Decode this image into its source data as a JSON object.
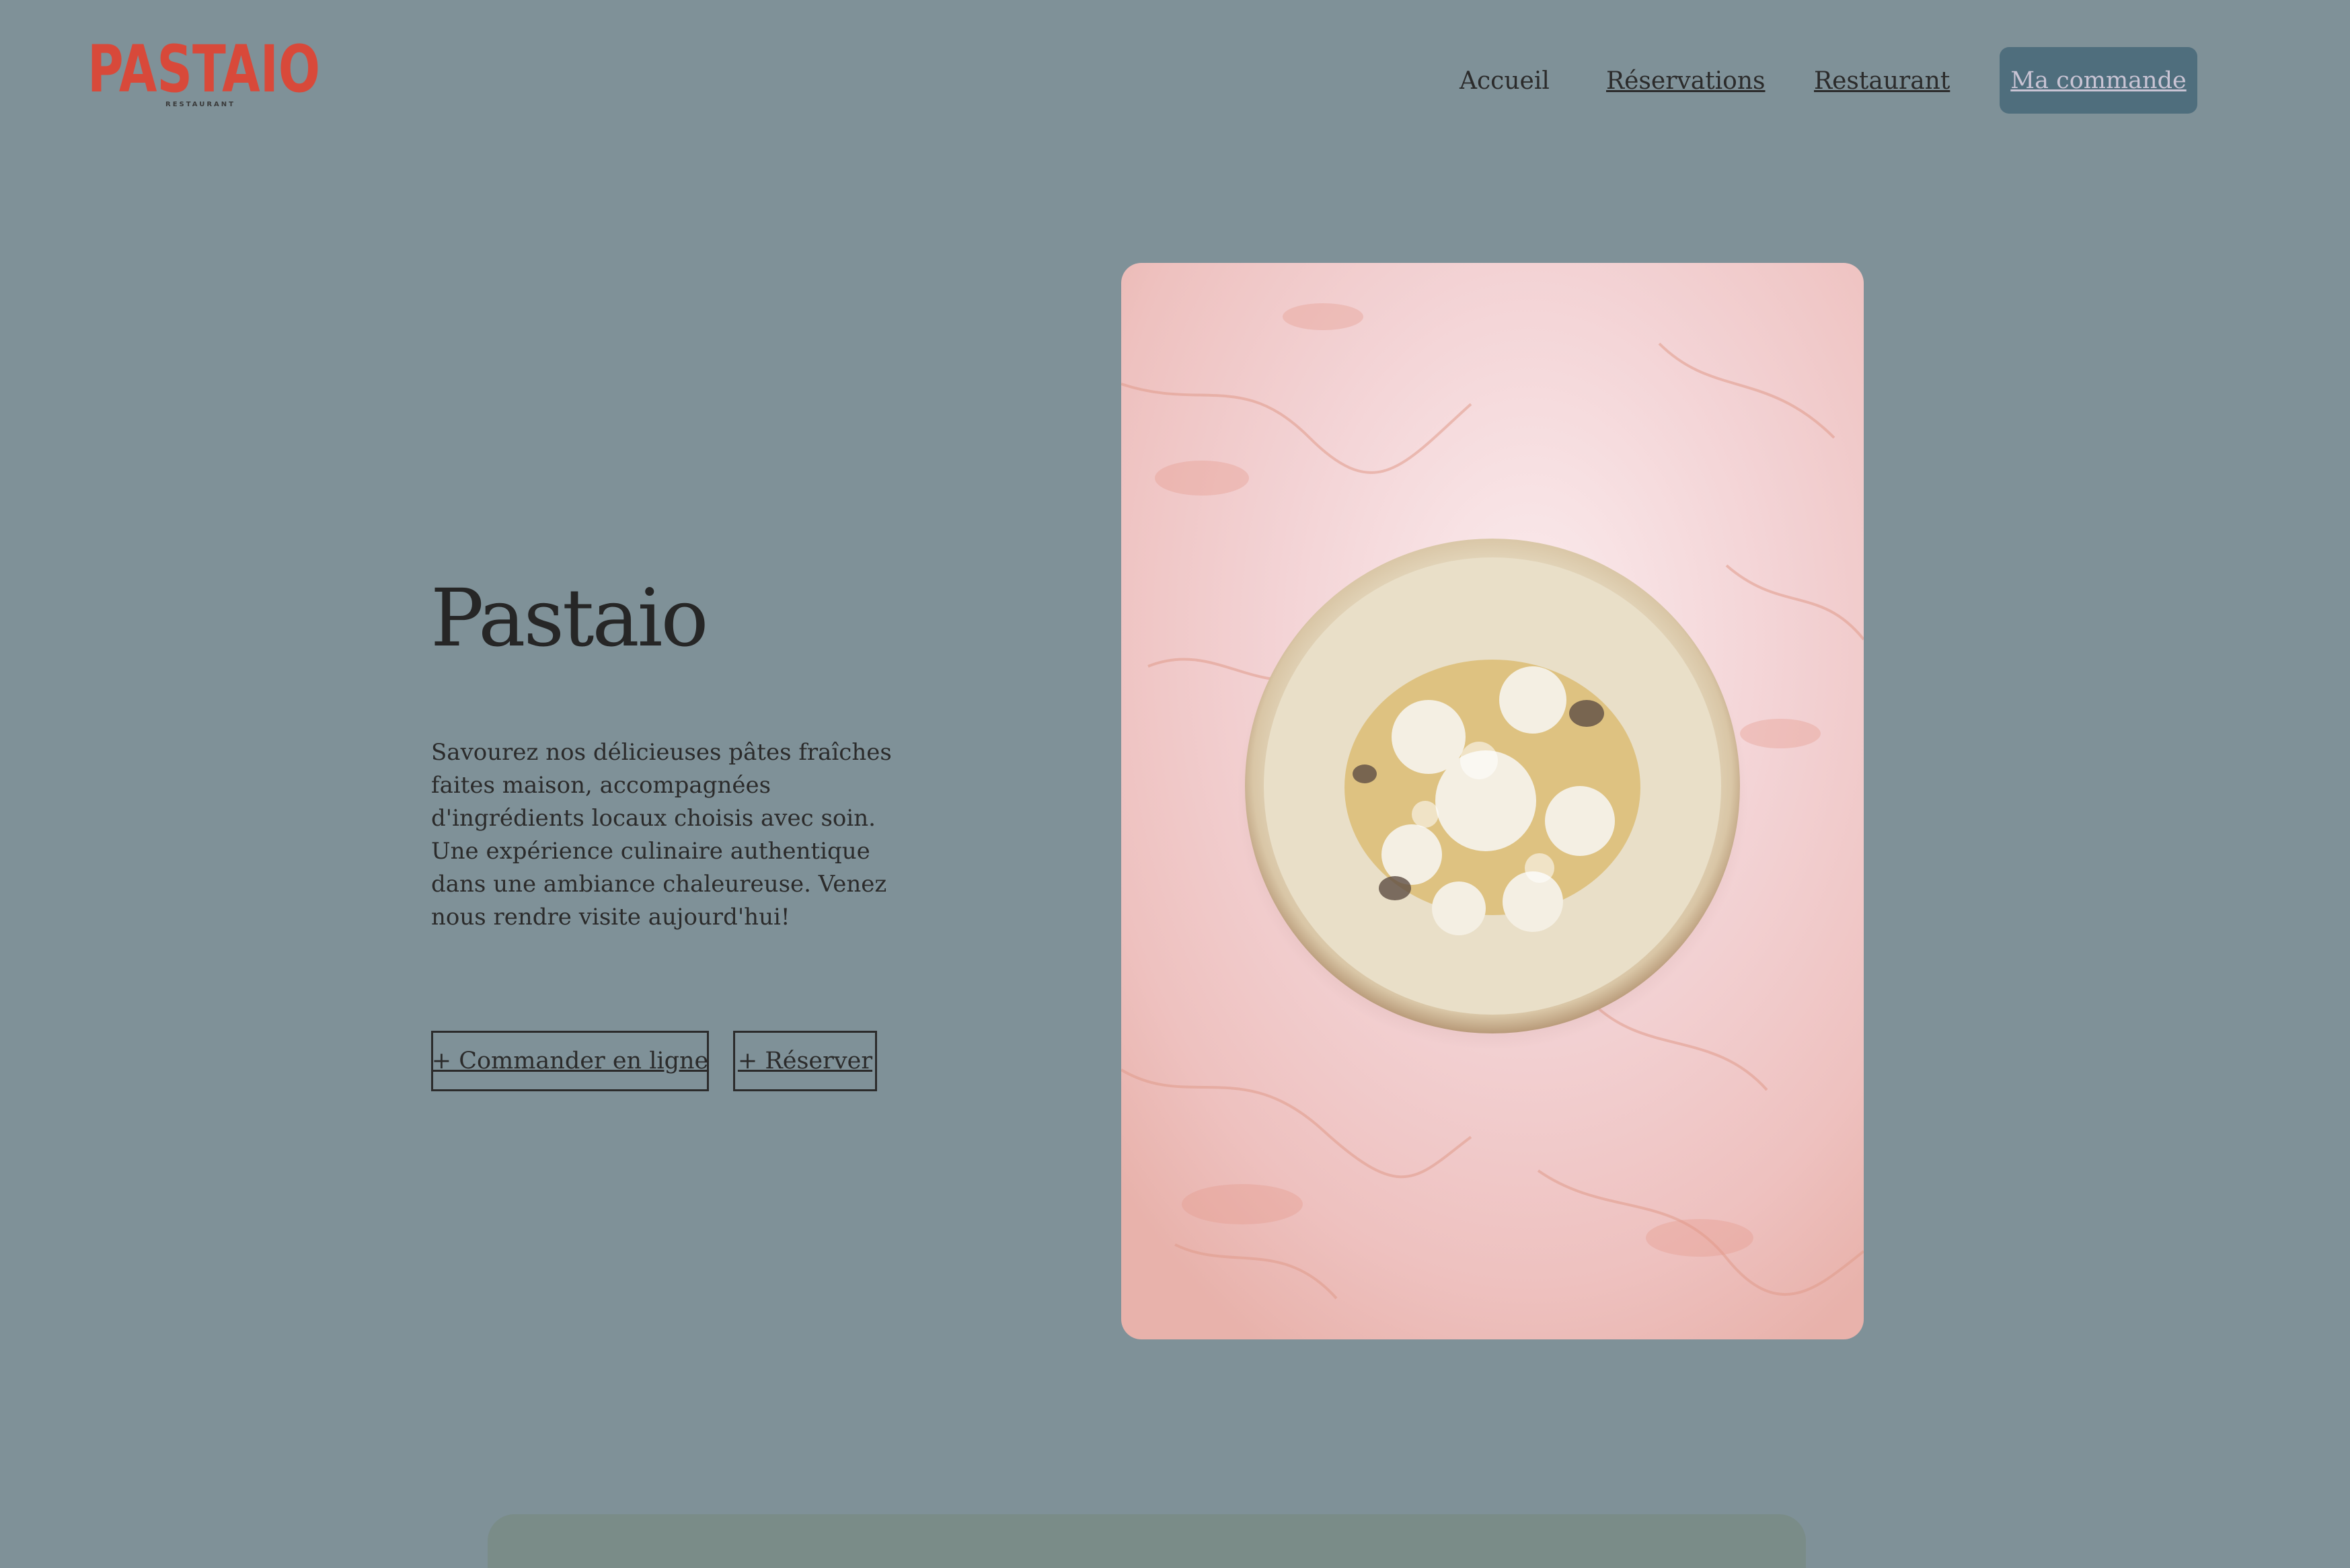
{
  "brand": {
    "logo_text": "PASTAIO",
    "logo_subtext": "RESTAURANT",
    "logo_color": "#d8493a"
  },
  "nav": {
    "items": [
      {
        "label": "Accueil"
      },
      {
        "label": "Réservations"
      },
      {
        "label": "Restaurant"
      }
    ],
    "order_label": "Ma commande"
  },
  "hero": {
    "title": "Pastaio",
    "description": "Savourez nos délicieuses pâtes fraîches faites maison, accompagnées d'ingrédients locaux choisis avec soin. Une expérience culinaire authentique dans une ambiance chaleureuse. Venez nous rendre visite aujourd'hui!",
    "buttons": [
      {
        "label": "+ Commander en ligne"
      },
      {
        "label": "+ Réserver"
      }
    ],
    "image_subject": "ravioli-plate-on-pink-marble"
  },
  "colors": {
    "background": "#7f9198",
    "order_button": "#4f6e7d",
    "order_button_text": "#c9c4d4",
    "text": "#2b2b2b"
  }
}
